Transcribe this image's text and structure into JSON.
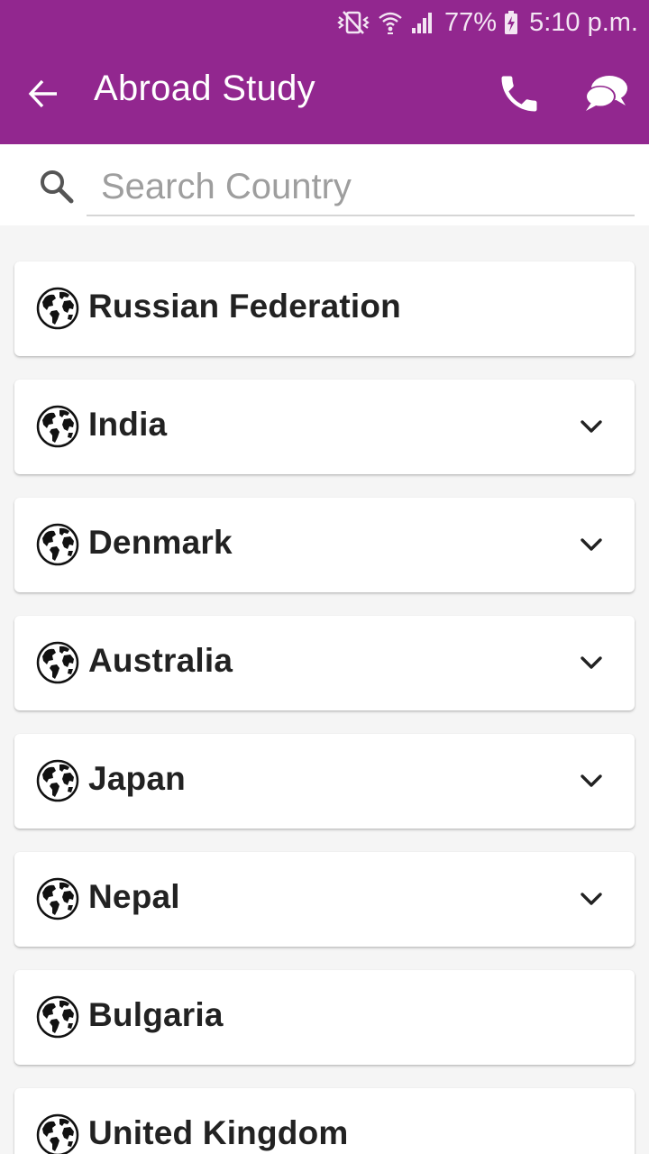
{
  "status_bar": {
    "battery_percent": "77%",
    "time": "5:10 p.m."
  },
  "app_bar": {
    "title": "Abroad Study",
    "back_icon": "arrow-back-icon",
    "phone_icon": "phone-icon",
    "chat_icon": "chat-icon"
  },
  "search": {
    "placeholder": "Search Country",
    "value": "",
    "icon": "search-icon"
  },
  "countries": [
    {
      "label": "Russian Federation",
      "expandable": false
    },
    {
      "label": "India",
      "expandable": true
    },
    {
      "label": "Denmark",
      "expandable": true
    },
    {
      "label": "Australia",
      "expandable": true
    },
    {
      "label": "Japan",
      "expandable": true
    },
    {
      "label": "Nepal",
      "expandable": true
    },
    {
      "label": "Bulgaria",
      "expandable": false
    },
    {
      "label": "United Kingdom",
      "expandable": false
    }
  ],
  "colors": {
    "primary": "#92278f",
    "background": "#f5f5f5",
    "card": "#ffffff",
    "text": "#222222"
  }
}
